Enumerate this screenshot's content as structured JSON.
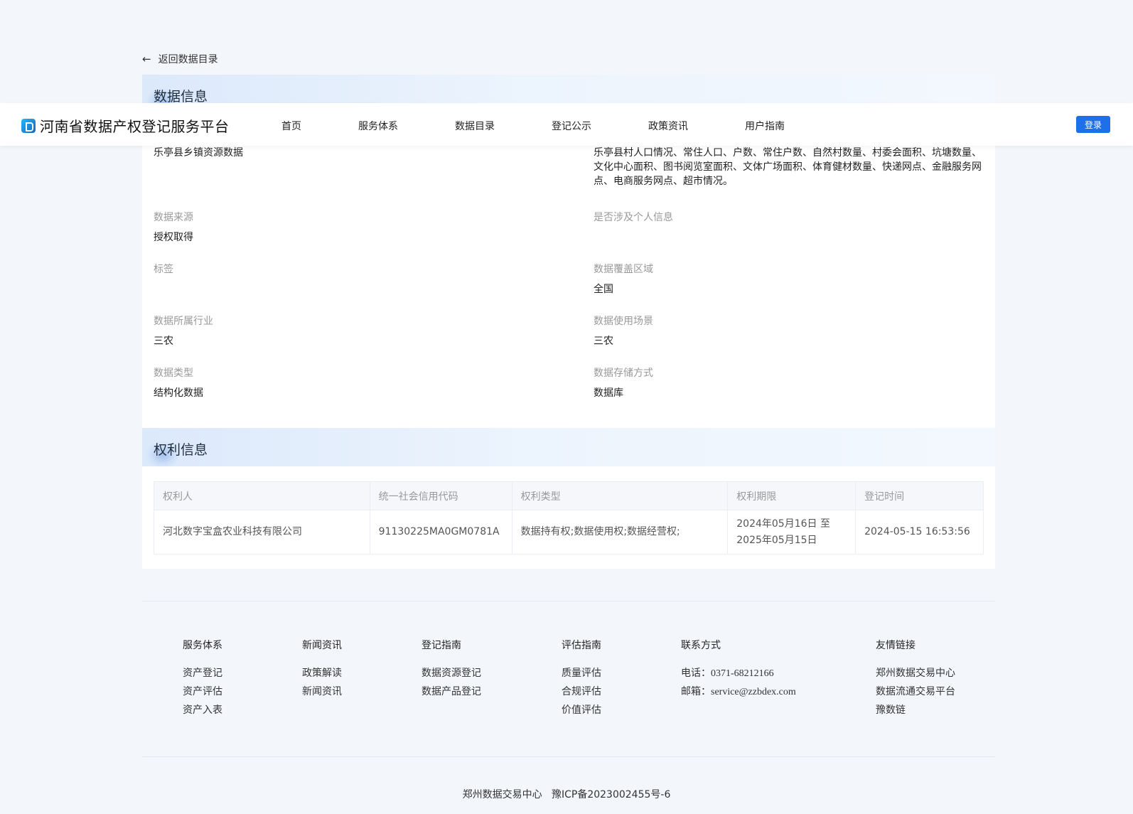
{
  "back_link": "返回数据目录",
  "info_section": {
    "title": "数据信息",
    "data_name": "乐亭县乡镇资源数据",
    "data_description": "乐亭县村人口情况、常住人口、户数、常住户数、自然村数量、村委会面积、坑塘数量、文化中心面积、图书阅览室面积、文体广场面积、体育健材数量、快递网点、金融服务网点、电商服务网点、超市情况。",
    "fields": {
      "source": {
        "label": "数据来源",
        "value": "授权取得"
      },
      "personal_info": {
        "label": "是否涉及个人信息",
        "value": ""
      },
      "tags": {
        "label": "标签",
        "value": ""
      },
      "coverage": {
        "label": "数据覆盖区域",
        "value": "全国"
      },
      "industry": {
        "label": "数据所属行业",
        "value": "三农"
      },
      "scenario": {
        "label": "数据使用场景",
        "value": "三农"
      },
      "type": {
        "label": "数据类型",
        "value": "结构化数据"
      },
      "storage": {
        "label": "数据存储方式",
        "value": "数据库"
      }
    }
  },
  "rights_section": {
    "title": "权利信息",
    "headers": [
      "权利人",
      "统一社会信用代码",
      "权利类型",
      "权利期限",
      "登记时间"
    ],
    "row": {
      "holder": "河北数字宝盒农业科技有限公司",
      "credit_code": "91130225MA0GM0781A",
      "rights_type": "数据持有权;数据使用权;数据经营权;",
      "term_start": "2024年05月16日 至",
      "term_end": "2025年05月15日",
      "reg_time": "2024-05-15 16:53:56"
    }
  },
  "navbar": {
    "brand": "河南省数据产权登记服务平台",
    "items": [
      "首页",
      "服务体系",
      "数据目录",
      "登记公示",
      "政策资讯",
      "用户指南"
    ],
    "login": "登录",
    "colors": {
      "accent": "#1e70e8"
    }
  },
  "footer": {
    "service": {
      "title": "服务体系",
      "links": [
        "资产登记",
        "资产评估",
        "资产入表"
      ]
    },
    "news": {
      "title": "新闻资讯",
      "links": [
        "政策解读",
        "新闻资讯"
      ]
    },
    "guide": {
      "title": "登记指南",
      "links": [
        "数据资源登记",
        "数据产品登记"
      ]
    },
    "eval": {
      "title": "评估指南",
      "links": [
        "质量评估",
        "合规评估",
        "价值评估"
      ]
    },
    "contact": {
      "title": "联系方式",
      "phone_label": "电话：",
      "phone": "0371-68212166",
      "email_label": "邮箱：",
      "email": "service@zzbdex.com"
    },
    "friends": {
      "title": "友情链接",
      "links": [
        "郑州数据交易中心",
        "数据流通交易平台",
        "豫数链"
      ]
    },
    "copyright": "郑州数据交易中心   豫ICP备2023002455号-6"
  }
}
